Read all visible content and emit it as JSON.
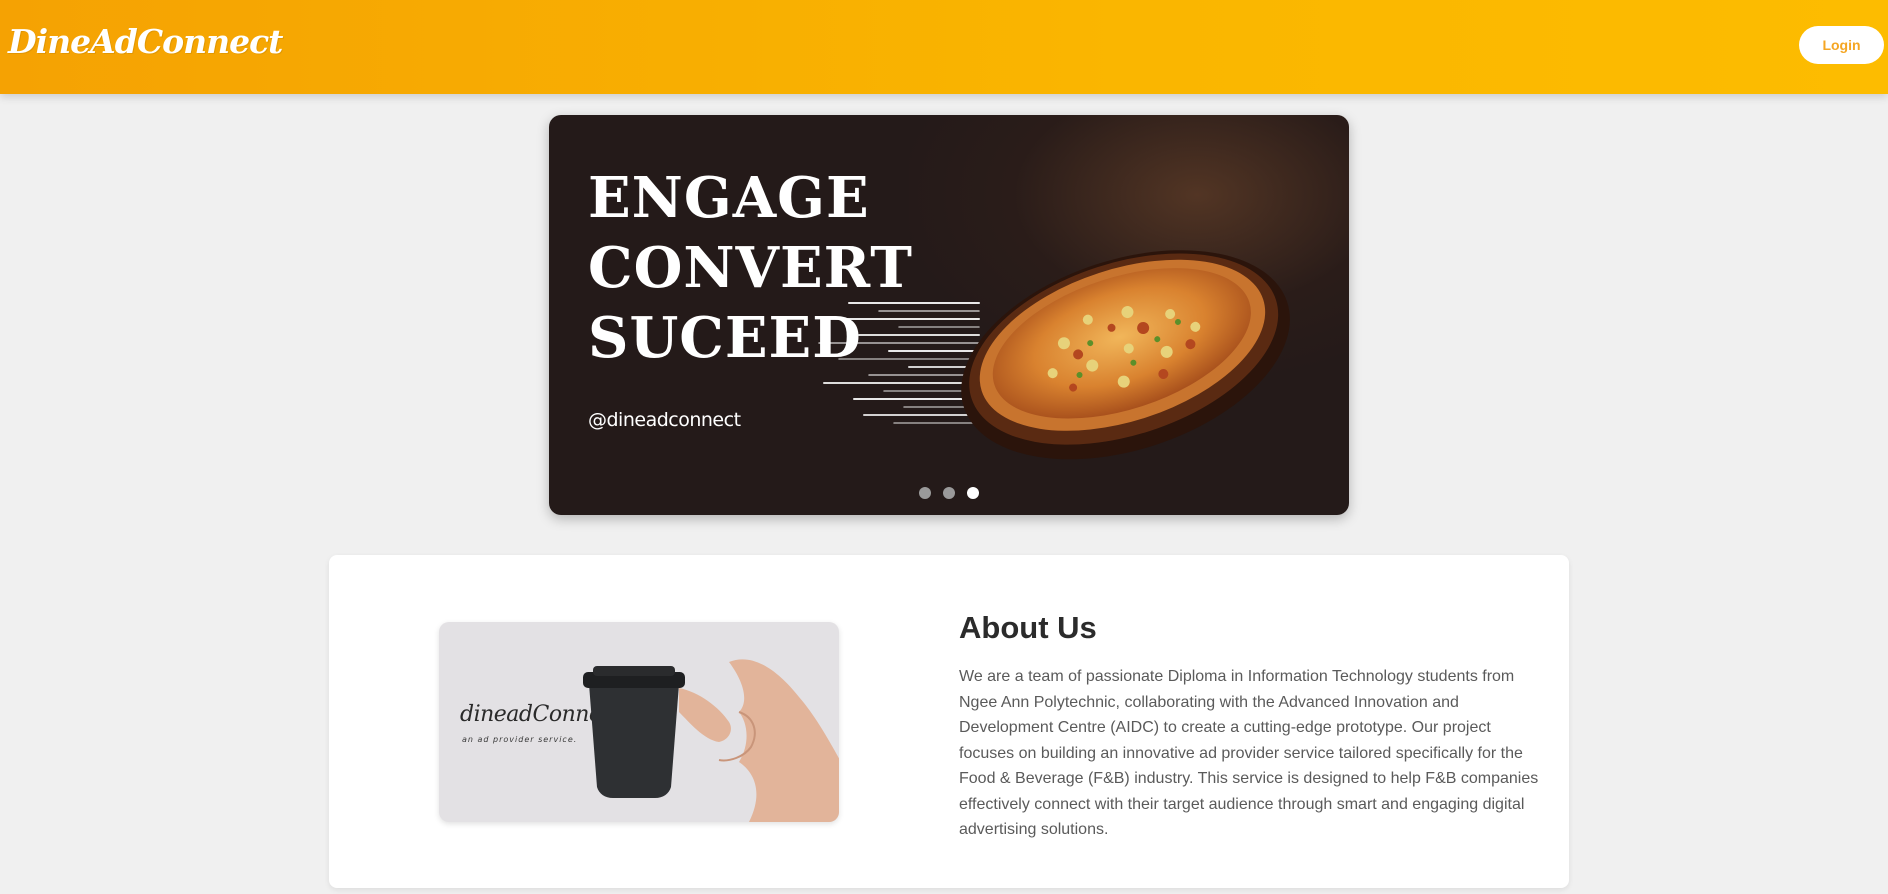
{
  "navbar": {
    "logo_text": "DineAdConnect",
    "login_label": "Login",
    "gradient_start": "#f5a203",
    "gradient_end": "#fdbc00"
  },
  "carousel": {
    "headline_lines": [
      "ENGAGE",
      "CONVERT",
      "SUCEED"
    ],
    "handle": "@dineadconnect",
    "slide_count": 3,
    "active_slide": 3
  },
  "about": {
    "title": "About Us",
    "image_brand": "dineadConnect",
    "image_tagline": "an ad provider service.",
    "body": "We are a team of passionate Diploma in Information Technology students from Ngee Ann Polytechnic, collaborating with the Advanced Innovation and Development Centre (AIDC) to create a cutting-edge prototype. Our project focuses on building an innovative ad provider service tailored specifically for the Food & Beverage (F&B) industry. This service is designed to help F&B companies effectively connect with their target audience through smart and engaging digital advertising solutions."
  },
  "colors": {
    "accent": "#f5a623",
    "page_background": "#f0f0f0",
    "carousel_background": "#241a19"
  }
}
